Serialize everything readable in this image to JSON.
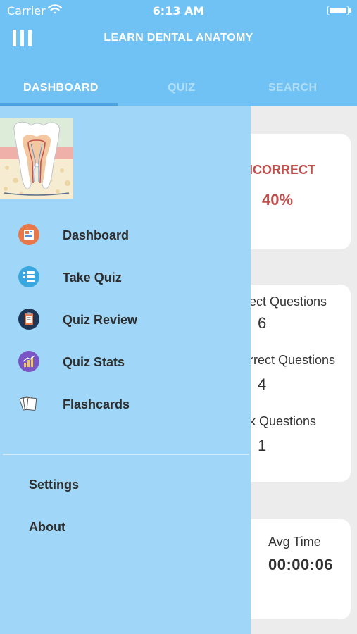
{
  "status_bar": {
    "carrier": "Carrier",
    "time": "6:13 AM"
  },
  "header": {
    "title": "LEARN DENTAL ANATOMY"
  },
  "tabs": [
    {
      "label": "DASHBOARD",
      "active": true
    },
    {
      "label": "QUIZ",
      "active": false
    },
    {
      "label": "SEARCH",
      "active": false
    }
  ],
  "dashboard": {
    "incorrect_label": "ICORRECT",
    "incorrect_value": "40%",
    "questions": [
      {
        "label": "ect Questions",
        "value": "6"
      },
      {
        "label": "rrect Questions",
        "value": "4"
      },
      {
        "label": "k Questions",
        "value": "1"
      }
    ],
    "avg_time_label": "Avg Time",
    "avg_time_value": "00:00:06"
  },
  "drawer": {
    "menu": [
      {
        "label": "Dashboard",
        "icon": "dashboard-icon"
      },
      {
        "label": "Take Quiz",
        "icon": "take-quiz-icon"
      },
      {
        "label": "Quiz Review",
        "icon": "clipboard-icon"
      },
      {
        "label": "Quiz Stats",
        "icon": "stats-icon"
      },
      {
        "label": "Flashcards",
        "icon": "flashcards-icon"
      }
    ],
    "settings": [
      {
        "label": "Settings"
      },
      {
        "label": "About"
      }
    ]
  },
  "colors": {
    "header_bg": "#6fc2f3",
    "drawer_bg": "#a0d7f8",
    "incorrect": "#c0504d",
    "tab_indicator": "#4aa3df"
  }
}
